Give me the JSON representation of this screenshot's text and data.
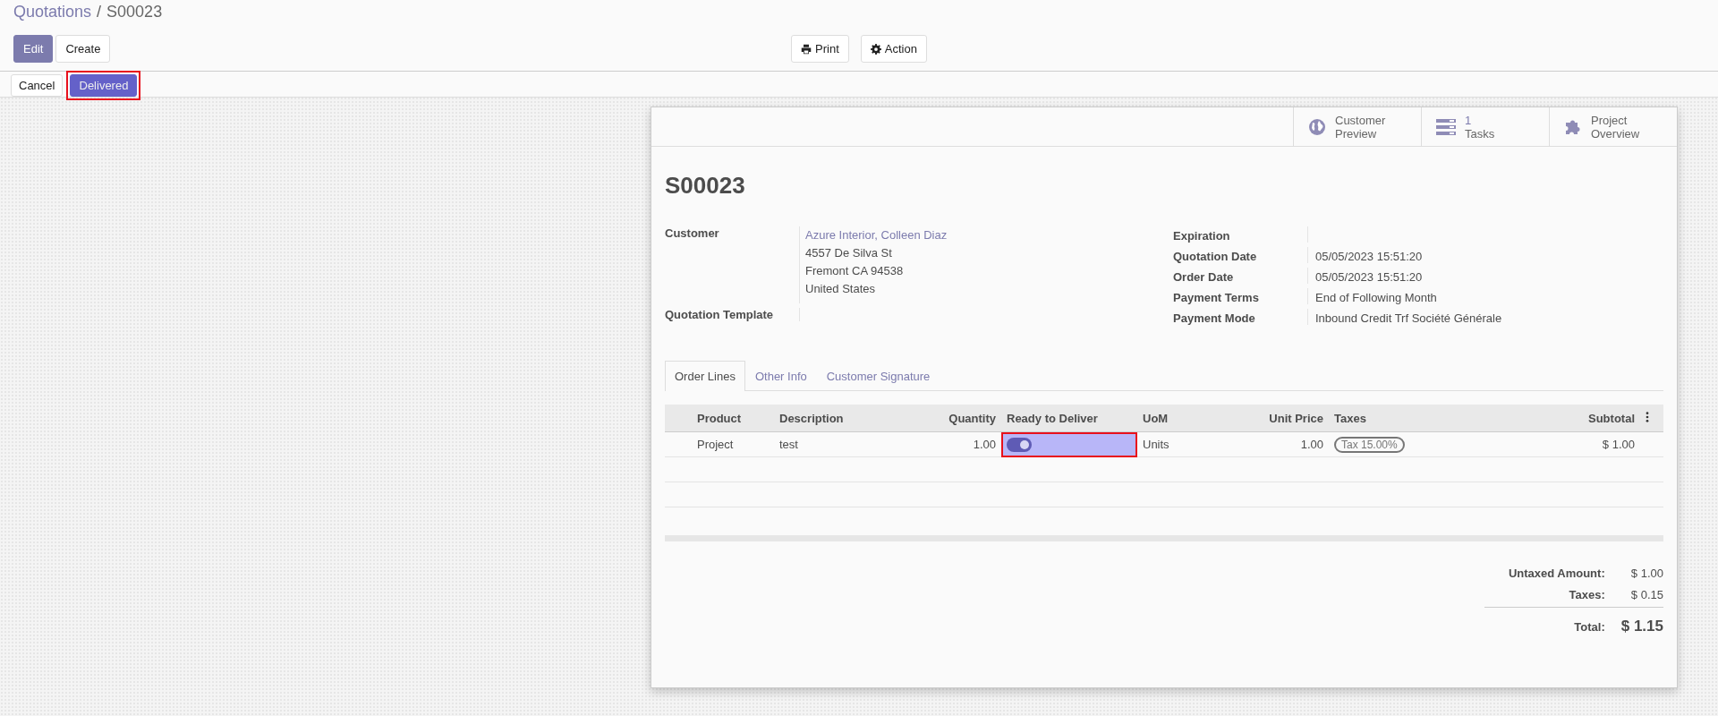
{
  "breadcrumb": {
    "parent": "Quotations",
    "separator": "/",
    "current": "S00023"
  },
  "toolbar": {
    "left_buttons": [
      {
        "label": "Edit",
        "kind": "primary"
      },
      {
        "label": "Create",
        "kind": "secondary"
      }
    ],
    "right_buttons": [
      {
        "label": "Print",
        "kind": "print"
      },
      {
        "label": "Action",
        "kind": "action"
      }
    ]
  },
  "status_buttons": [
    {
      "label": "Cancel",
      "kind": "secondary",
      "highlighted": false
    },
    {
      "label": "Delivered",
      "kind": "primary",
      "highlighted": true
    }
  ],
  "smart_buttons": [
    {
      "kind": "preview",
      "label": "Customer Preview"
    },
    {
      "kind": "tasks",
      "value": "1",
      "label": "Tasks"
    },
    {
      "kind": "project",
      "label": "Project Overview"
    }
  ],
  "title": "S00023",
  "left_fields": [
    {
      "label": "Customer",
      "link": "Azure Interior, Colleen Diaz",
      "lines": [
        "4557 De Silva St",
        "Fremont CA 94538",
        "United States"
      ]
    },
    {
      "label": "Quotation Template"
    }
  ],
  "right_fields": [
    {
      "label": "Expiration"
    },
    {
      "label": "Quotation Date",
      "value": "05/05/2023 15:51:20"
    },
    {
      "label": "Order Date",
      "value": "05/05/2023 15:51:20"
    },
    {
      "label": "Payment Terms",
      "value": "End of Following Month"
    },
    {
      "label": "Payment Mode",
      "value": "Inbound Credit Trf Société Générale"
    }
  ],
  "tabs": [
    {
      "label": "Order Lines",
      "selected": true
    },
    {
      "label": "Other Info",
      "selected": false
    },
    {
      "label": "Customer Signature",
      "selected": false
    }
  ],
  "table": {
    "columns": [
      "Product",
      "Description",
      "Quantity",
      "Ready to Deliver",
      "UoM",
      "Unit Price",
      "Taxes",
      "Subtotal"
    ],
    "rows": [
      {
        "cells": [
          {
            "kind": "text",
            "text": "Project"
          },
          {
            "kind": "text",
            "text": "test"
          },
          {
            "kind": "text",
            "text": "1.00"
          },
          {
            "kind": "toggle",
            "on": true,
            "highlighted": true
          },
          {
            "kind": "text",
            "text": "Units"
          },
          {
            "kind": "text",
            "text": "1.00"
          },
          {
            "kind": "tag",
            "text": "Tax 15.00%"
          },
          {
            "kind": "text",
            "text": "$ 1.00"
          }
        ]
      }
    ]
  },
  "totals": [
    {
      "label": "Untaxed Amount:",
      "value": "$ 1.00",
      "kind": "line"
    },
    {
      "label": "Taxes:",
      "value": "$ 0.15",
      "kind": "line"
    },
    {
      "label": "Total:",
      "value": "$ 1.15",
      "kind": "grand"
    }
  ]
}
